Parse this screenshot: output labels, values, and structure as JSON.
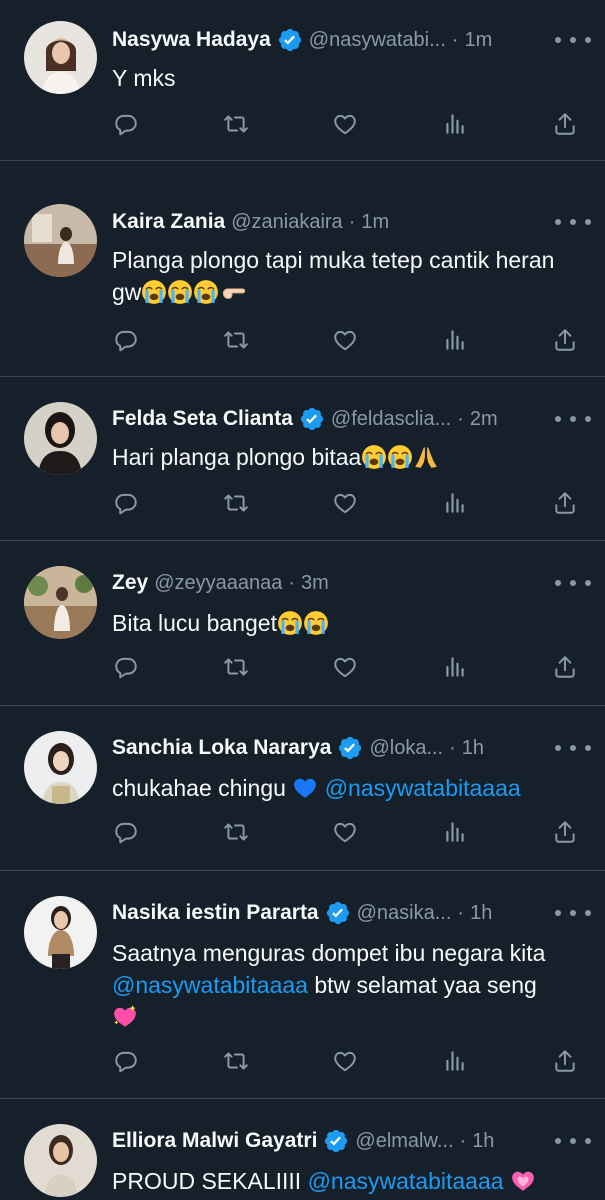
{
  "tweets": [
    {
      "name": "Nasywa Hadaya",
      "verified": true,
      "handle": "@nasywatabi...",
      "sep": "·",
      "time": "1m",
      "text": "Y mks"
    },
    {
      "name": "Kaira Zania",
      "verified": false,
      "handle": "@zaniakaira",
      "sep": "·",
      "time": "1m",
      "text": "Planga plongo tapi muka tetep cantik heran gw"
    },
    {
      "name": "Felda Seta Clianta",
      "verified": true,
      "handle": "@feldasclia...",
      "sep": "·",
      "time": "2m",
      "text": "Hari planga plongo bitaa"
    },
    {
      "name": "Zey",
      "verified": false,
      "handle": "@zeyyaaanaa",
      "sep": "·",
      "time": "3m",
      "text": "Bita lucu banget"
    },
    {
      "name": "Sanchia Loka Nararya",
      "verified": true,
      "handle": "@loka...",
      "sep": "·",
      "time": "1h",
      "text": "chukahae chingu",
      "mention": "@nasywatabitaaaa"
    },
    {
      "name": "Nasika iestin Pararta",
      "verified": true,
      "handle": "@nasika...",
      "sep": "·",
      "time": "1h",
      "text": "Saatnya menguras dompet ibu negara kita",
      "mention": "@nasywatabitaaaa",
      "text_after": "btw selamat yaa seng"
    },
    {
      "name": "Elliora Malwi Gayatri",
      "verified": true,
      "handle": "@elmalw...",
      "sep": "·",
      "time": "1h",
      "text": "PROUD SEKALIIII",
      "mention": "@nasywatabitaaaa"
    }
  ],
  "icons": {
    "reply": "reply-icon",
    "retweet": "retweet-icon",
    "like": "like-icon",
    "views": "views-icon",
    "share": "share-icon",
    "verified": "verified-badge-icon",
    "more": "more-options-icon"
  },
  "colors": {
    "background": "#15202b",
    "text": "#f7f9f9",
    "secondary": "#8b98a5",
    "accent": "#1d9bf0",
    "divider": "#38444d"
  }
}
